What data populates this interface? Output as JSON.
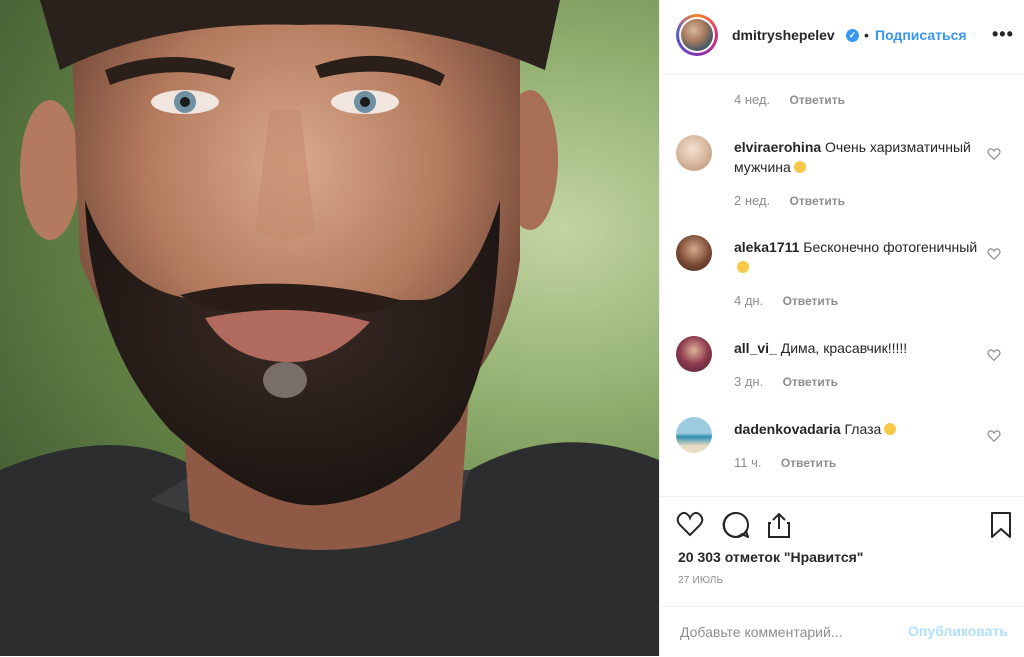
{
  "post": {
    "username": "dmitryshepelev",
    "verified": true,
    "separator": "•",
    "follow_label": "Подписаться",
    "more_label": "•••"
  },
  "comments": {
    "first_meta": {
      "time": "4 нед.",
      "reply_label": "Ответить"
    },
    "items": [
      {
        "user": "elviraerohina",
        "text": "Очень харизматичный мужчина",
        "time": "2 нед.",
        "reply_label": "Ответить",
        "emoji": "smile",
        "avatar_color": "#e8d2bf"
      },
      {
        "user": "aleka1711",
        "text": "Бесконечно фотогеничный",
        "time": "4 дн.",
        "reply_label": "Ответить",
        "emoji": "heart-eyes",
        "avatar_color": "#5a3a2e"
      },
      {
        "user": "all_vi_",
        "text": "Дима, красавчик!!!!!",
        "time": "3 дн.",
        "reply_label": "Ответить",
        "emoji": "",
        "avatar_color": "#4a2330"
      },
      {
        "user": "dadenkovadaria",
        "text": "Глаза",
        "time": "11 ч.",
        "reply_label": "Ответить",
        "emoji": "heart-eyes",
        "avatar_color": "#7fb6c9"
      }
    ]
  },
  "actions": {
    "likes_text": "20 303 отметок \"Нравится\"",
    "date_text": "27 ИЮЛЬ",
    "icons": [
      "heart-icon",
      "comment-icon",
      "share-icon",
      "bookmark-icon"
    ]
  },
  "add_comment": {
    "placeholder": "Добавьте комментарий...",
    "publish_label": "Опубликовать"
  },
  "colors": {
    "accent": "#3897f0",
    "publish_disabled": "#b2dffc",
    "muted": "#8e8e8e",
    "text": "#262626",
    "border": "#efefef"
  }
}
